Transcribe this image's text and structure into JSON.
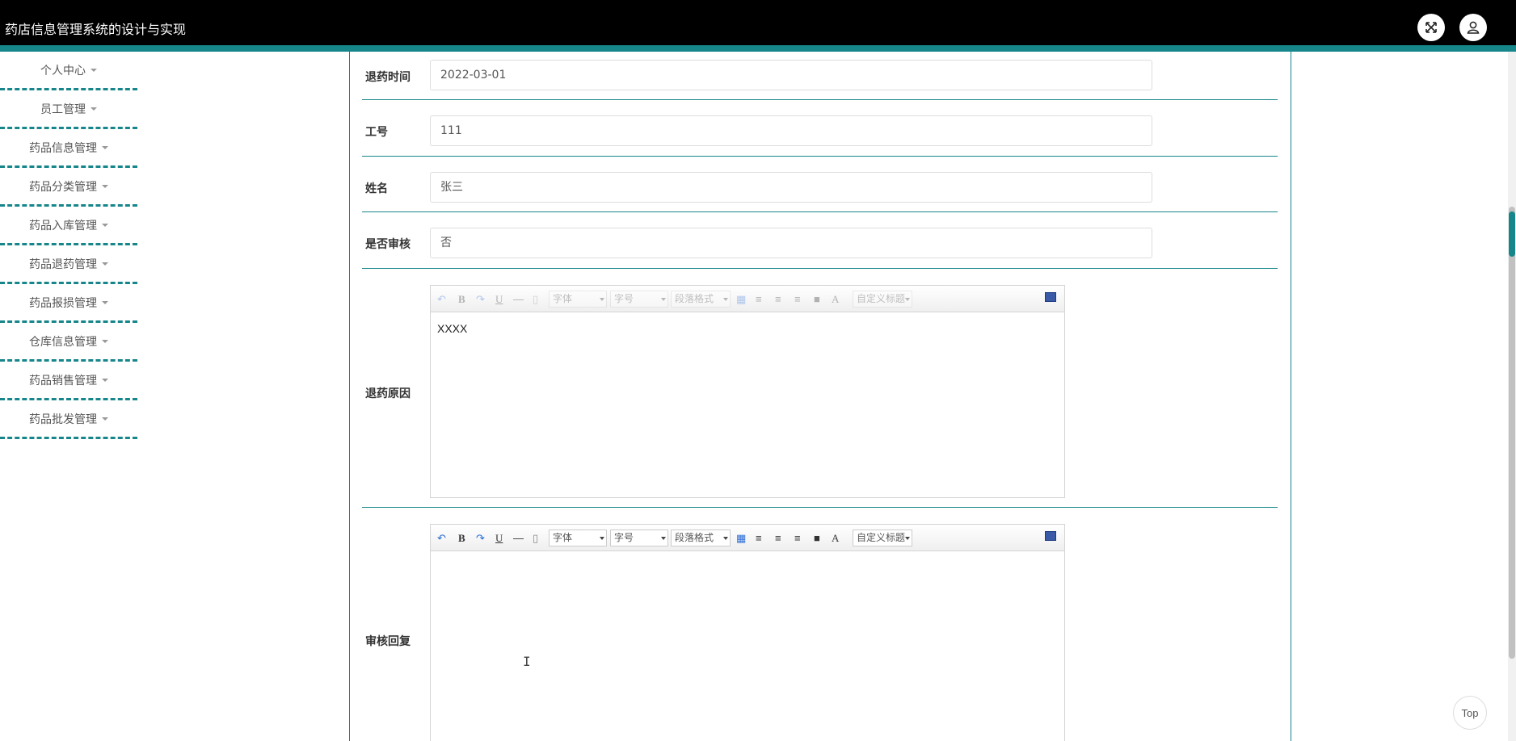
{
  "app": {
    "title": "药店信息管理系统的设计与实现"
  },
  "header": {
    "fullscreen_icon": "fullscreen-icon",
    "user_icon": "user-icon",
    "accent_color": "#16868a"
  },
  "sidebar": {
    "items": [
      {
        "label": "个人中心"
      },
      {
        "label": "员工管理"
      },
      {
        "label": "药品信息管理"
      },
      {
        "label": "药品分类管理"
      },
      {
        "label": "药品入库管理"
      },
      {
        "label": "药品退药管理"
      },
      {
        "label": "药品报损管理"
      },
      {
        "label": "仓库信息管理"
      },
      {
        "label": "药品销售管理"
      },
      {
        "label": "药品批发管理"
      }
    ]
  },
  "form": {
    "return_time": {
      "label": "退药时间",
      "value": "2022-03-01"
    },
    "employee_id": {
      "label": "工号",
      "value": "111"
    },
    "name": {
      "label": "姓名",
      "value": "张三"
    },
    "reviewed": {
      "label": "是否审核",
      "value": "否"
    },
    "return_reason": {
      "label": "退药原因",
      "value": "XXXX"
    },
    "review_reply": {
      "label": "审核回复",
      "value": ""
    }
  },
  "editor_toolbar": {
    "bold": "B",
    "underline": "U",
    "font_color": "A",
    "font_select": "字体",
    "size_select": "字号",
    "paragraph_select": "段落格式",
    "custom_title_select": "自定义标题",
    "custom_title_short": "自定义标题"
  },
  "back_to_top": {
    "label": "Top"
  }
}
